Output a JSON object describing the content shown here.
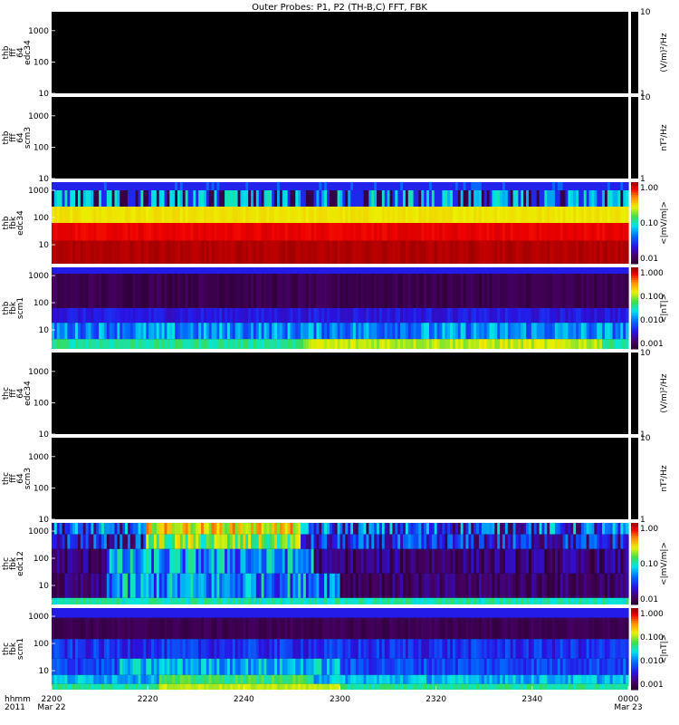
{
  "title": "Outer Probes: P1, P2 (TH-B,C) FFT, FBK",
  "chart_data": {
    "type": "heatmap",
    "x_axis": {
      "xlim": [
        "22:00",
        "00:00"
      ],
      "row_label_1": "hhmm",
      "row_label_2": "2011",
      "ticks": [
        {
          "time": "22:00",
          "label": "2200",
          "sub": "Mar 22"
        },
        {
          "time": "22:20",
          "label": "2220",
          "sub": ""
        },
        {
          "time": "22:40",
          "label": "2240",
          "sub": ""
        },
        {
          "time": "23:00",
          "label": "2300",
          "sub": ""
        },
        {
          "time": "23:20",
          "label": "2320",
          "sub": ""
        },
        {
          "time": "23:40",
          "label": "2340",
          "sub": ""
        },
        {
          "time": "00:00",
          "label": "0000",
          "sub": "Mar 23"
        }
      ]
    },
    "panels": [
      {
        "name": "thb-fff-64-edc34",
        "ylabel": [
          "thb",
          "fff",
          "64",
          "edc34"
        ],
        "y_scale": "log",
        "ylim": [
          10,
          4000
        ],
        "y_ticks": [
          "10",
          "100",
          "1000"
        ],
        "colorbar": {
          "type": "gray",
          "ticks": [
            "1",
            "10"
          ],
          "unit": "(V/m)²/Hz"
        },
        "pattern": "empty"
      },
      {
        "name": "thb-fff-64-scm3",
        "ylabel": [
          "thb",
          "fff",
          "64",
          "scm3"
        ],
        "y_scale": "log",
        "ylim": [
          10,
          4000
        ],
        "y_ticks": [
          "10",
          "100",
          "1000"
        ],
        "colorbar": {
          "type": "gray",
          "ticks": [
            "1",
            "10"
          ],
          "unit": "nT²/Hz"
        },
        "pattern": "empty"
      },
      {
        "name": "thb-fbk-edc34",
        "ylabel": [
          "thb",
          "fbk",
          "edc34"
        ],
        "y_scale": "log",
        "ylim": [
          2,
          2000
        ],
        "y_ticks": [
          "10",
          "100",
          "1000"
        ],
        "colorbar": {
          "type": "rainbow",
          "ticks": [
            "0.01",
            "0.10",
            "1.00"
          ],
          "unit": "<|mV/m|>"
        },
        "pattern": "efield_b"
      },
      {
        "name": "thb-fbk-scm1",
        "ylabel": [
          "thb",
          "fbk",
          "scm1"
        ],
        "y_scale": "log",
        "ylim": [
          2,
          2000
        ],
        "y_ticks": [
          "10",
          "100",
          "1000"
        ],
        "colorbar": {
          "type": "rainbow",
          "ticks": [
            "0.001",
            "0.010",
            "0.100",
            "1.000"
          ],
          "unit": "<|nT|>"
        },
        "pattern": "bfield_b"
      },
      {
        "name": "thc-fff-64-edc34",
        "ylabel": [
          "thc",
          "fff",
          "64",
          "edc34"
        ],
        "y_scale": "log",
        "ylim": [
          10,
          4000
        ],
        "y_ticks": [
          "10",
          "100",
          "1000"
        ],
        "colorbar": {
          "type": "gray",
          "ticks": [
            "1",
            "10"
          ],
          "unit": "(V/m)²/Hz"
        },
        "pattern": "empty"
      },
      {
        "name": "thc-fff-64-scm3",
        "ylabel": [
          "thc",
          "fff",
          "64",
          "scm3"
        ],
        "y_scale": "log",
        "ylim": [
          10,
          4000
        ],
        "y_ticks": [
          "10",
          "100",
          "1000"
        ],
        "colorbar": {
          "type": "gray",
          "ticks": [
            "1",
            "10"
          ],
          "unit": "nT²/Hz"
        },
        "pattern": "empty"
      },
      {
        "name": "thc-fbk-edc12",
        "ylabel": [
          "thc",
          "fbk",
          "edc12"
        ],
        "y_scale": "log",
        "ylim": [
          2,
          2000
        ],
        "y_ticks": [
          "10",
          "100",
          "1000"
        ],
        "colorbar": {
          "type": "rainbow",
          "ticks": [
            "0.01",
            "0.10",
            "1.00"
          ],
          "unit": "<|mV/m|>"
        },
        "pattern": "efield_c"
      },
      {
        "name": "thc-fbk-scm1",
        "ylabel": [
          "thc",
          "fbk",
          "scm1"
        ],
        "y_scale": "log",
        "ylim": [
          2,
          2000
        ],
        "y_ticks": [
          "10",
          "100",
          "1000"
        ],
        "colorbar": {
          "type": "rainbow",
          "ticks": [
            "0.001",
            "0.010",
            "0.100",
            "1.000"
          ],
          "unit": "<|nT|>"
        },
        "pattern": "bfield_c"
      }
    ]
  }
}
